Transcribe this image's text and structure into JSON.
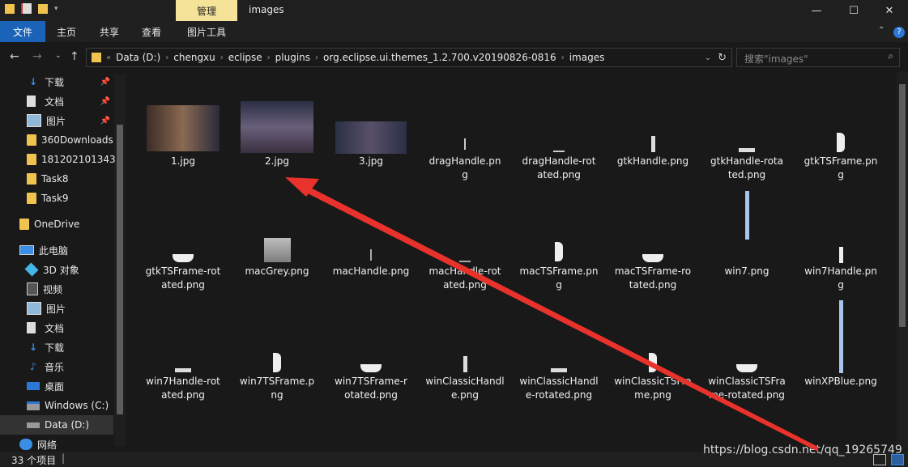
{
  "window": {
    "title": "images",
    "context_tab": "管理",
    "controls": [
      "—",
      "☐",
      "✕"
    ]
  },
  "ribbon": {
    "tabs": [
      "文件",
      "主页",
      "共享",
      "查看",
      "图片工具"
    ]
  },
  "address": {
    "prefix": "«",
    "crumbs": [
      "Data (D:)",
      "chengxu",
      "eclipse",
      "plugins",
      "org.eclipse.ui.themes_1.2.700.v20190826-0816",
      "images"
    ],
    "search_placeholder": "搜索\"images\""
  },
  "sidebar": {
    "quick": [
      {
        "label": "下载",
        "icon": "download-icon",
        "pinned": true
      },
      {
        "label": "文档",
        "icon": "document-icon",
        "pinned": true
      },
      {
        "label": "图片",
        "icon": "picture-icon",
        "pinned": true
      },
      {
        "label": "360Downloads",
        "icon": "folder-icon"
      },
      {
        "label": "181202101343",
        "icon": "folder-icon"
      },
      {
        "label": "Task8",
        "icon": "folder-icon"
      },
      {
        "label": "Task9",
        "icon": "folder-icon"
      }
    ],
    "onedrive": "OneDrive",
    "thispc": "此电脑",
    "pc_items": [
      {
        "label": "3D 对象",
        "icon": "3d-objects-icon"
      },
      {
        "label": "视频",
        "icon": "video-icon"
      },
      {
        "label": "图片",
        "icon": "picture-icon"
      },
      {
        "label": "文档",
        "icon": "document-icon"
      },
      {
        "label": "下载",
        "icon": "download-icon"
      },
      {
        "label": "音乐",
        "icon": "music-icon"
      },
      {
        "label": "桌面",
        "icon": "desktop-icon"
      },
      {
        "label": "Windows (C:)",
        "icon": "drive-icon"
      },
      {
        "label": "Data (D:)",
        "icon": "drive-icon",
        "selected": true
      }
    ],
    "network": "网络"
  },
  "files": [
    {
      "name1": "1.jpg",
      "name2": ""
    },
    {
      "name1": "2.jpg",
      "name2": ""
    },
    {
      "name1": "3.jpg",
      "name2": ""
    },
    {
      "name1": "dragHandle.pn",
      "name2": "g"
    },
    {
      "name1": "dragHandle-rot",
      "name2": "ated.png"
    },
    {
      "name1": "gtkHandle.png",
      "name2": ""
    },
    {
      "name1": "gtkHandle-rota",
      "name2": "ted.png"
    },
    {
      "name1": "gtkTSFrame.pn",
      "name2": "g"
    },
    {
      "name1": "gtkTSFrame-rot",
      "name2": "ated.png"
    },
    {
      "name1": "macGrey.png",
      "name2": ""
    },
    {
      "name1": "macHandle.png",
      "name2": ""
    },
    {
      "name1": "macHandle-rot",
      "name2": "ated.png"
    },
    {
      "name1": "macTSFrame.pn",
      "name2": "g"
    },
    {
      "name1": "macTSFrame-ro",
      "name2": "tated.png"
    },
    {
      "name1": "win7.png",
      "name2": ""
    },
    {
      "name1": "win7Handle.pn",
      "name2": "g"
    },
    {
      "name1": "win7Handle-rot",
      "name2": "ated.png"
    },
    {
      "name1": "win7TSFrame.p",
      "name2": "ng"
    },
    {
      "name1": "win7TSFrame-r",
      "name2": "otated.png"
    },
    {
      "name1": "winClassicHandl",
      "name2": "e.png"
    },
    {
      "name1": "winClassicHandl",
      "name2": "e-rotated.png"
    },
    {
      "name1": "winClassicTSFra",
      "name2": "me.png"
    },
    {
      "name1": "winClassicTSFra",
      "name2": "me-rotated.png"
    },
    {
      "name1": "winXPBlue.png",
      "name2": ""
    }
  ],
  "status": {
    "count": "33 个项目",
    "watermark": "https://blog.csdn.net/qq_19265749"
  },
  "colors": {
    "accent": "#1b63b8",
    "context_tab": "#f5e39a",
    "annotation_arrow": "#e8322b"
  }
}
